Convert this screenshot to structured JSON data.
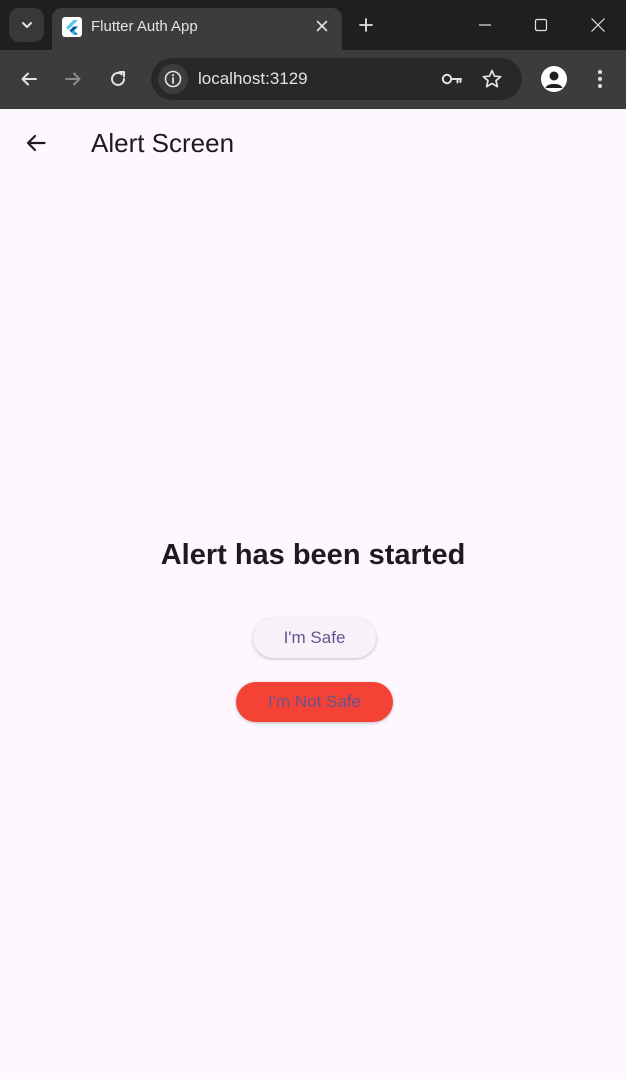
{
  "browser": {
    "tab": {
      "title": "Flutter Auth App",
      "favicon": "flutter-logo-icon"
    },
    "address_bar": {
      "url": "localhost:3129"
    },
    "icons": {
      "tab_search": "chevron-down-icon",
      "tab_close": "close-icon",
      "new_tab": "plus-icon",
      "minimize": "minimize-icon",
      "maximize": "maximize-icon",
      "close_window": "close-icon",
      "back": "arrow-left-icon",
      "forward": "arrow-right-icon",
      "reload": "reload-icon",
      "site_info": "info-icon",
      "passwords": "key-icon",
      "bookmark": "star-icon",
      "profile": "profile-icon",
      "menu": "more-vert-icon"
    }
  },
  "app": {
    "appbar": {
      "title": "Alert Screen",
      "back_icon": "arrow-back-icon"
    },
    "body": {
      "headline": "Alert has been started",
      "safe_button_label": "I'm Safe",
      "not_safe_button_label": "I'm Not Safe"
    },
    "colors": {
      "background": "#fef7ff",
      "text": "#1d1b20",
      "button_text": "#65558f",
      "safe_button_bg": "#f7f2fa",
      "not_safe_button_bg": "#f44336",
      "chrome_dark": "#1f1f1f",
      "chrome_toolbar": "#3c3c3c"
    }
  }
}
